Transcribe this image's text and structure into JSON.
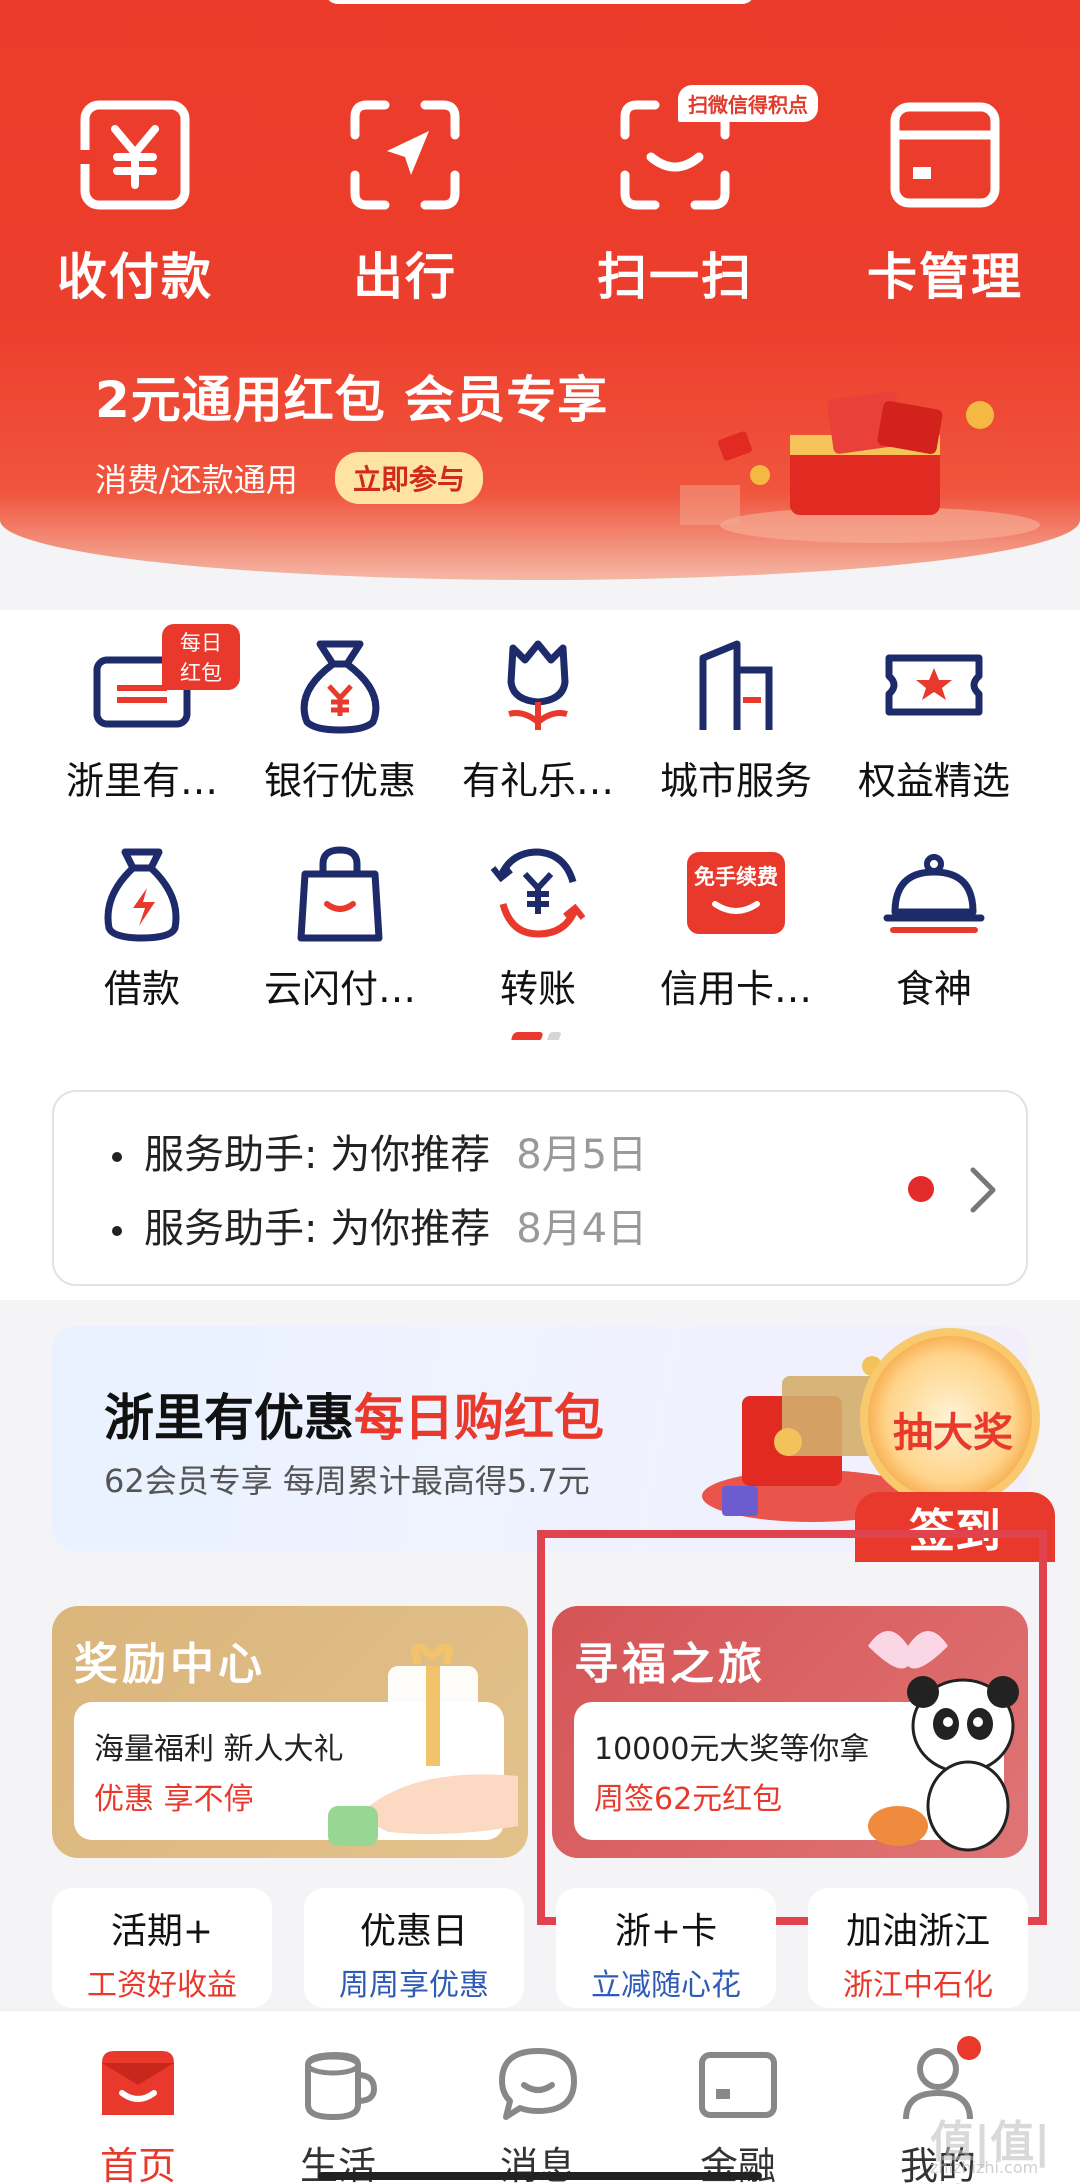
{
  "quick_actions": [
    {
      "label": "收付款",
      "icon": "yuan-frame-icon"
    },
    {
      "label": "出行",
      "icon": "navigation-arrow-icon"
    },
    {
      "label": "扫一扫",
      "icon": "scan-icon"
    },
    {
      "label": "卡管理",
      "icon": "card-icon"
    }
  ],
  "scan_tag": "扫微信得积点",
  "promo": {
    "title": "2元通用红包 会员专享",
    "subtitle": "消费/还款通用",
    "button": "立即参与"
  },
  "services_row1": [
    {
      "label": "浙里有…",
      "icon": "ticket-icon",
      "tag": "每日红包"
    },
    {
      "label": "银行优惠",
      "icon": "money-bag-icon"
    },
    {
      "label": "有礼乐…",
      "icon": "tulip-icon"
    },
    {
      "label": "城市服务",
      "icon": "building-icon"
    },
    {
      "label": "权益精选",
      "icon": "star-ticket-icon"
    }
  ],
  "services_row2": [
    {
      "label": "借款",
      "icon": "lightning-bag-icon"
    },
    {
      "label": "云闪付…",
      "icon": "shopping-bag-icon"
    },
    {
      "label": "转账",
      "icon": "transfer-icon"
    },
    {
      "label": "信用卡…",
      "icon": "free-fee-icon",
      "badge": "免手续费"
    },
    {
      "label": "食神",
      "icon": "dish-cover-icon"
    }
  ],
  "notices": [
    {
      "text": "服务助手: 为你推荐",
      "date": "8月5日"
    },
    {
      "text": "服务助手: 为你推荐",
      "date": "8月4日"
    }
  ],
  "banner": {
    "title_a": "浙里有优惠",
    "title_b": "每日购红包",
    "subtitle": "62会员专享 每周累计最高得5.7元",
    "wheel_text": "抽大奖",
    "sign_text": "签到"
  },
  "cards": {
    "reward": {
      "title": "奖励中心",
      "line1": "海量福利 新人大礼",
      "line2": "优惠 享不停"
    },
    "journey": {
      "title": "寻福之旅",
      "line1": "10000元大奖等你拿",
      "line2": "周签62元红包"
    }
  },
  "minis": [
    {
      "title": "活期+",
      "sub": "工资好收益",
      "sub_color": "#e8392c"
    },
    {
      "title": "优惠日",
      "sub": "周周享优惠",
      "sub_color": "#2f5bb7"
    },
    {
      "title": "浙+卡",
      "sub": "立减随心花",
      "sub_color": "#2f5bb7"
    },
    {
      "title": "加油浙江",
      "sub": "浙江中石化",
      "sub_color": "#e8392c"
    }
  ],
  "tabs": [
    {
      "label": "首页",
      "icon": "home-icon",
      "active": true
    },
    {
      "label": "生活",
      "icon": "cup-icon"
    },
    {
      "label": "消息",
      "icon": "chat-bubble-icon"
    },
    {
      "label": "金融",
      "icon": "wallet-card-icon"
    },
    {
      "label": "我的",
      "icon": "user-icon"
    }
  ],
  "watermark": "值|值|值",
  "watermark_url": "zhizhizhi.com",
  "colors": {
    "brand_red": "#e8392c",
    "navy": "#1d2b6b"
  }
}
